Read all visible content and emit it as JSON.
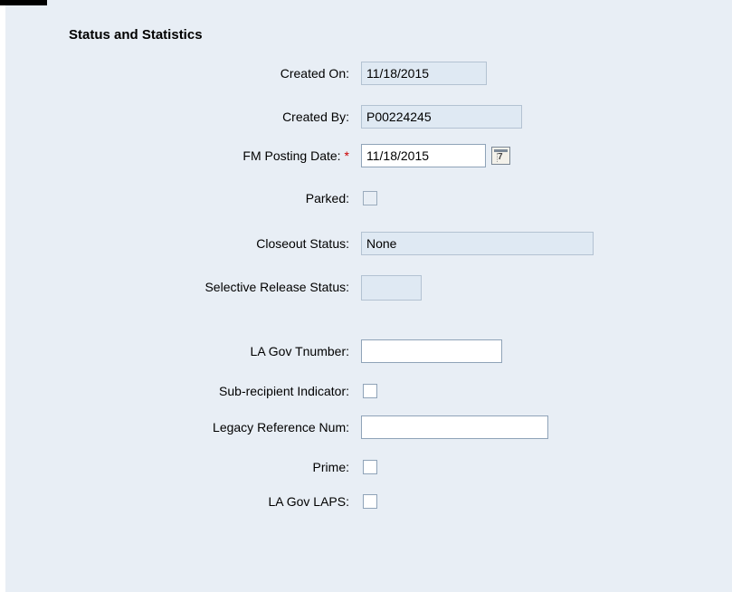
{
  "section": {
    "title": "Status and Statistics"
  },
  "fields": {
    "created_on": {
      "label": "Created On:",
      "value": "11/18/2015"
    },
    "created_by": {
      "label": "Created By:",
      "value": "P00224245"
    },
    "fm_posting_date": {
      "label": "FM Posting Date:",
      "required_marker": "*",
      "value": "11/18/2015"
    },
    "parked": {
      "label": "Parked:",
      "checked": false
    },
    "closeout_status": {
      "label": "Closeout Status:",
      "value": "None"
    },
    "selective_release_status": {
      "label": "Selective Release Status:",
      "value": ""
    },
    "la_gov_tnumber": {
      "label": "LA Gov Tnumber:",
      "value": ""
    },
    "sub_recipient_indicator": {
      "label": "Sub-recipient Indicator:",
      "checked": false
    },
    "legacy_reference_num": {
      "label": "Legacy Reference Num:",
      "value": ""
    },
    "prime": {
      "label": "Prime:",
      "checked": false
    },
    "la_gov_laps": {
      "label": "LA Gov LAPS:",
      "checked": false
    }
  },
  "icons": {
    "date_picker": "calendar-icon"
  }
}
